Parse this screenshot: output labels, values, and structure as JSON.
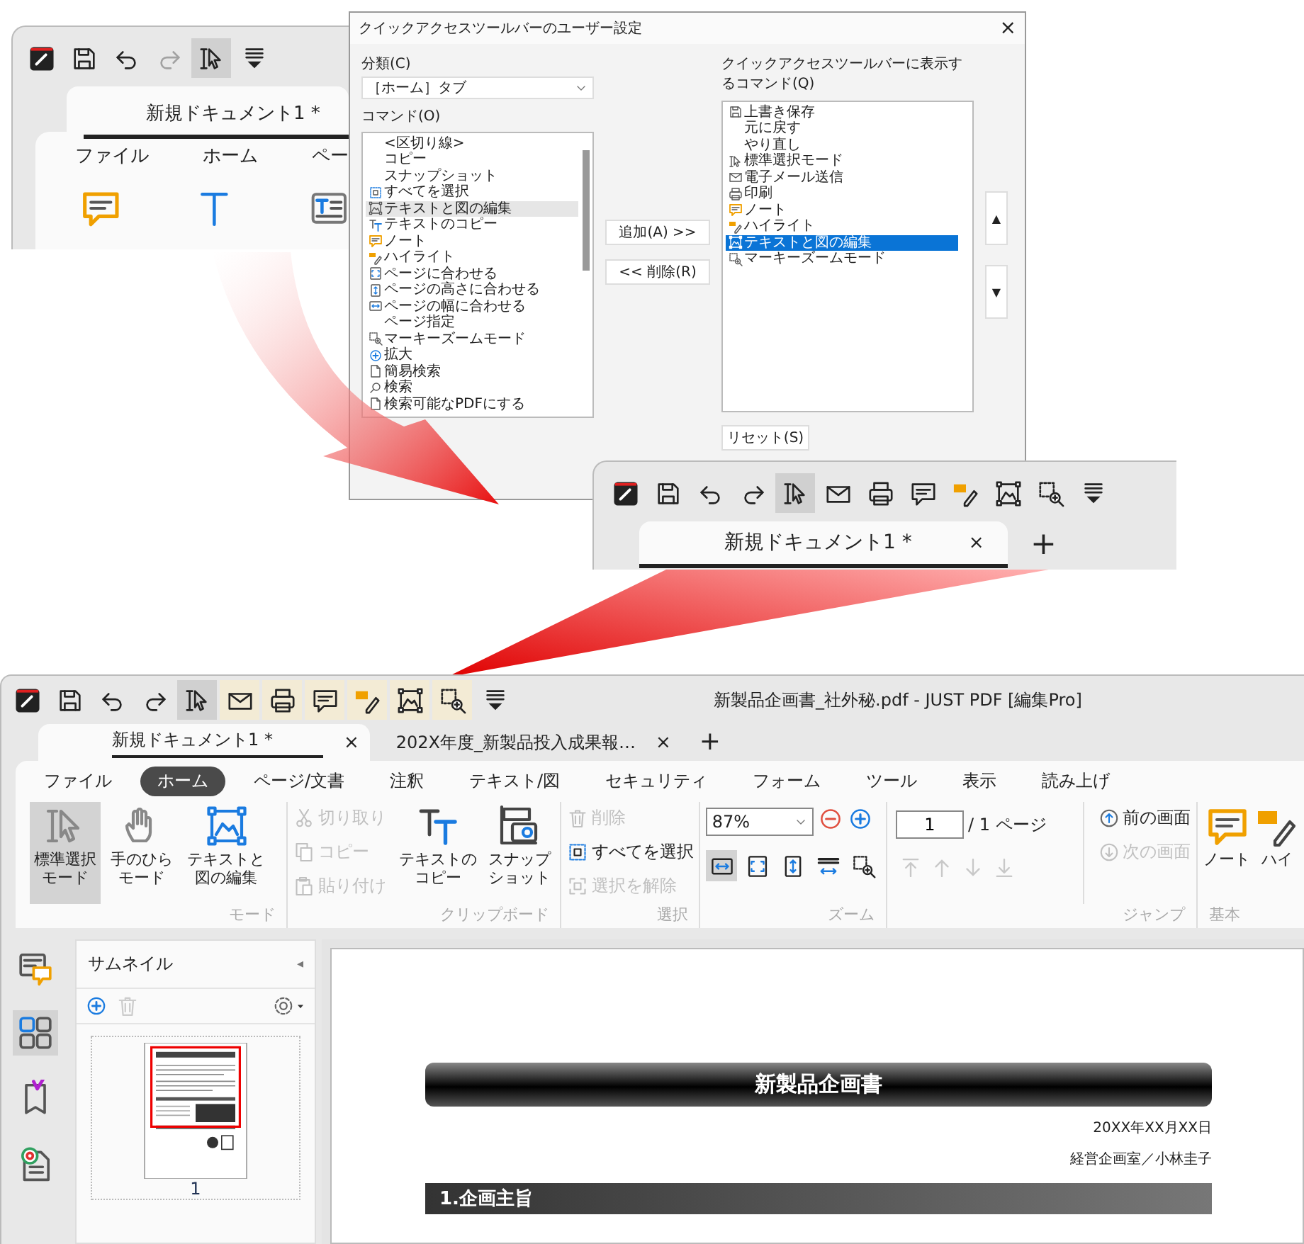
{
  "top_crop": {
    "toolbar": [
      {
        "kind": "app",
        "selected": false,
        "disabled": false
      },
      {
        "kind": "save",
        "selected": false,
        "disabled": false
      },
      {
        "kind": "undo",
        "selected": false,
        "disabled": false
      },
      {
        "kind": "redo",
        "selected": false,
        "disabled": true
      },
      {
        "kind": "cursor",
        "selected": true,
        "disabled": false
      },
      {
        "kind": "more",
        "selected": false,
        "disabled": false
      }
    ],
    "tab": "新規ドキュメント1 *",
    "menu": [
      "ファイル",
      "ホーム",
      "ペー"
    ],
    "ribbon_icons": [
      {
        "kind": "note"
      },
      {
        "kind": "text"
      },
      {
        "kind": "textbox"
      }
    ]
  },
  "dialog": {
    "title": "クイックアクセスツールバーのユーザー設定",
    "close": "×",
    "category_label": "分類(C)",
    "category_value": "［ホーム］タブ",
    "commands_label": "コマンド(O)",
    "commands": [
      {
        "label": "<区切り線>",
        "kind": "plain",
        "selected": false
      },
      {
        "label": "コピー",
        "kind": "plain",
        "selected": false
      },
      {
        "label": "スナップショット",
        "kind": "plain",
        "selected": false
      },
      {
        "label": "すべてを選択",
        "kind": "selectall",
        "selected": false
      },
      {
        "label": "テキストと図の編集",
        "kind": "image",
        "selected": true
      },
      {
        "label": "テキストのコピー",
        "kind": "textcopy",
        "selected": false
      },
      {
        "label": "ノート",
        "kind": "note",
        "selected": false
      },
      {
        "label": "ハイライト",
        "kind": "highlight",
        "selected": false
      },
      {
        "label": "ページに合わせる",
        "kind": "fitpage",
        "selected": false
      },
      {
        "label": "ページの高さに合わせる",
        "kind": "fitheight",
        "selected": false
      },
      {
        "label": "ページの幅に合わせる",
        "kind": "fitwidth",
        "selected": false
      },
      {
        "label": "ページ指定",
        "kind": "plain",
        "selected": false
      },
      {
        "label": "マーキーズームモード",
        "kind": "zoom",
        "selected": false
      },
      {
        "label": "拡大",
        "kind": "plus",
        "selected": false
      },
      {
        "label": "簡易検索",
        "kind": "doc",
        "selected": false
      },
      {
        "label": "検索",
        "kind": "search",
        "selected": false
      },
      {
        "label": "検索可能なPDFにする",
        "kind": "doc",
        "selected": false
      }
    ],
    "add_button": "追加(A) >>",
    "remove_button": "<< 削除(R)",
    "toolbar_label": "クイックアクセスツールバーに表示するコマンド(Q)",
    "toolbar_commands": [
      {
        "label": "上書き保存",
        "kind": "save",
        "selected": false
      },
      {
        "label": "元に戻す",
        "kind": "plain",
        "selected": false
      },
      {
        "label": "やり直し",
        "kind": "plain",
        "selected": false
      },
      {
        "label": "標準選択モード",
        "kind": "cursor",
        "selected": false
      },
      {
        "label": "電子メール送信",
        "kind": "mail",
        "selected": false
      },
      {
        "label": "印刷",
        "kind": "print",
        "selected": false
      },
      {
        "label": "ノート",
        "kind": "note",
        "selected": false
      },
      {
        "label": "ハイライト",
        "kind": "highlight",
        "selected": false
      },
      {
        "label": "テキストと図の編集",
        "kind": "image",
        "selected": true
      },
      {
        "label": "マーキーズームモード",
        "kind": "zoom",
        "selected": false
      }
    ],
    "up_button": "▲",
    "down_button": "▼",
    "reset_button": "リセット(S)"
  },
  "mid_crop": {
    "toolbar": [
      {
        "kind": "app",
        "selected": false
      },
      {
        "kind": "save",
        "selected": false
      },
      {
        "kind": "undo",
        "selected": false
      },
      {
        "kind": "redo",
        "selected": false
      },
      {
        "kind": "cursor",
        "selected": true
      },
      {
        "kind": "mail",
        "selected": false
      },
      {
        "kind": "print",
        "selected": false
      },
      {
        "kind": "comment",
        "selected": false
      },
      {
        "kind": "highlight",
        "selected": false
      },
      {
        "kind": "image",
        "selected": false
      },
      {
        "kind": "zoom",
        "selected": false
      },
      {
        "kind": "more",
        "selected": false
      }
    ],
    "tab": "新規ドキュメント1 *",
    "tab_close": "×",
    "new_tab": "+"
  },
  "main": {
    "toolbar": [
      {
        "kind": "app",
        "selected": false,
        "highlighted": false
      },
      {
        "kind": "save",
        "selected": false,
        "highlighted": false
      },
      {
        "kind": "undo",
        "selected": false,
        "highlighted": false
      },
      {
        "kind": "redo",
        "selected": false,
        "highlighted": false
      },
      {
        "kind": "cursor",
        "selected": true,
        "highlighted": false
      },
      {
        "kind": "mail",
        "selected": false,
        "highlighted": true
      },
      {
        "kind": "print",
        "selected": false,
        "highlighted": true
      },
      {
        "kind": "comment",
        "selected": false,
        "highlighted": true
      },
      {
        "kind": "highlight",
        "selected": false,
        "highlighted": true
      },
      {
        "kind": "image",
        "selected": false,
        "highlighted": true
      },
      {
        "kind": "zoom",
        "selected": false,
        "highlighted": true
      },
      {
        "kind": "more",
        "selected": false,
        "highlighted": false
      }
    ],
    "title": "新製品企画書_社外秘.pdf - JUST PDF [編集Pro]",
    "doc_tabs": [
      {
        "label": "新規ドキュメント1 *",
        "close": "×",
        "selected": true
      },
      {
        "label": "202X年度_新製品投入成果報…",
        "close": "×",
        "selected": false
      }
    ],
    "new_tab": "+",
    "ribbon_tabs": [
      {
        "label": "ファイル",
        "selected": false
      },
      {
        "label": "ホーム",
        "selected": true
      },
      {
        "label": "ページ/文書",
        "selected": false
      },
      {
        "label": "注釈",
        "selected": false
      },
      {
        "label": "テキスト/図",
        "selected": false
      },
      {
        "label": "セキュリティ",
        "selected": false
      },
      {
        "label": "フォーム",
        "selected": false
      },
      {
        "label": "ツール",
        "selected": false
      },
      {
        "label": "表示",
        "selected": false
      },
      {
        "label": "読み上げ",
        "selected": false
      }
    ],
    "mode_group": {
      "label": "モード",
      "buttons": [
        {
          "kind": "cursor",
          "label": [
            "標準選択",
            "モード"
          ],
          "selected": true
        },
        {
          "kind": "hand",
          "label": [
            "手のひら",
            "モード"
          ],
          "selected": false
        },
        {
          "kind": "image",
          "label": [
            "テキストと",
            "図の編集"
          ],
          "selected": false
        }
      ]
    },
    "clipboard_group": {
      "label": "クリップボード",
      "small": [
        {
          "kind": "cut",
          "label": "切り取り",
          "disabled": true
        },
        {
          "kind": "copy",
          "label": "コピー",
          "disabled": true
        },
        {
          "kind": "paste",
          "label": "貼り付け",
          "disabled": true
        }
      ],
      "large": [
        {
          "kind": "textcopy",
          "label": [
            "テキストの",
            "コピー"
          ]
        },
        {
          "kind": "snapshot",
          "label": [
            "スナップ",
            "ショット"
          ]
        }
      ]
    },
    "select_group": {
      "label": "選択",
      "buttons": [
        {
          "kind": "trash",
          "label": "削除",
          "disabled": true
        },
        {
          "kind": "selectall",
          "label": "すべてを選択",
          "disabled": false
        },
        {
          "kind": "deselect",
          "label": "選択を解除",
          "disabled": true
        }
      ]
    },
    "zoom_group": {
      "label": "ズーム",
      "value": "87%",
      "view_buttons": [
        {
          "kind": "fitwidth",
          "selected": true
        },
        {
          "kind": "fitpage",
          "selected": false
        },
        {
          "kind": "fitheight",
          "selected": false
        },
        {
          "kind": "fitwidth2",
          "selected": false
        },
        {
          "kind": "zoom",
          "selected": false
        }
      ]
    },
    "jump_group": {
      "label": "ジャンプ",
      "page": "1",
      "total": "/ 1 ページ",
      "nav": [
        {
          "kind": "first",
          "disabled": true
        },
        {
          "kind": "up",
          "disabled": true
        },
        {
          "kind": "down",
          "disabled": true
        },
        {
          "kind": "last",
          "disabled": true
        }
      ],
      "history": [
        {
          "kind": "circleup",
          "label": "前の画面",
          "disabled": false
        },
        {
          "kind": "circledown",
          "label": "次の画面",
          "disabled": true
        }
      ]
    },
    "basic_group": {
      "label": "基本",
      "buttons": [
        {
          "kind": "note",
          "label": [
            "ノート"
          ]
        },
        {
          "kind": "highlight",
          "label": [
            "ハイ"
          ]
        }
      ]
    },
    "rail": [
      {
        "kind": "comments",
        "selected": false
      },
      {
        "kind": "thumbs",
        "selected": true
      },
      {
        "kind": "bookmark",
        "selected": false
      },
      {
        "kind": "attach",
        "selected": false
      }
    ],
    "panel": {
      "title": "サムネイル",
      "collapse": "◂",
      "thumb_label": "1"
    },
    "document": {
      "title": "新製品企画書",
      "date": "20XX年XX月XX日",
      "author": "経営企画室／小林圭子",
      "heading": "1.企画主旨"
    }
  }
}
